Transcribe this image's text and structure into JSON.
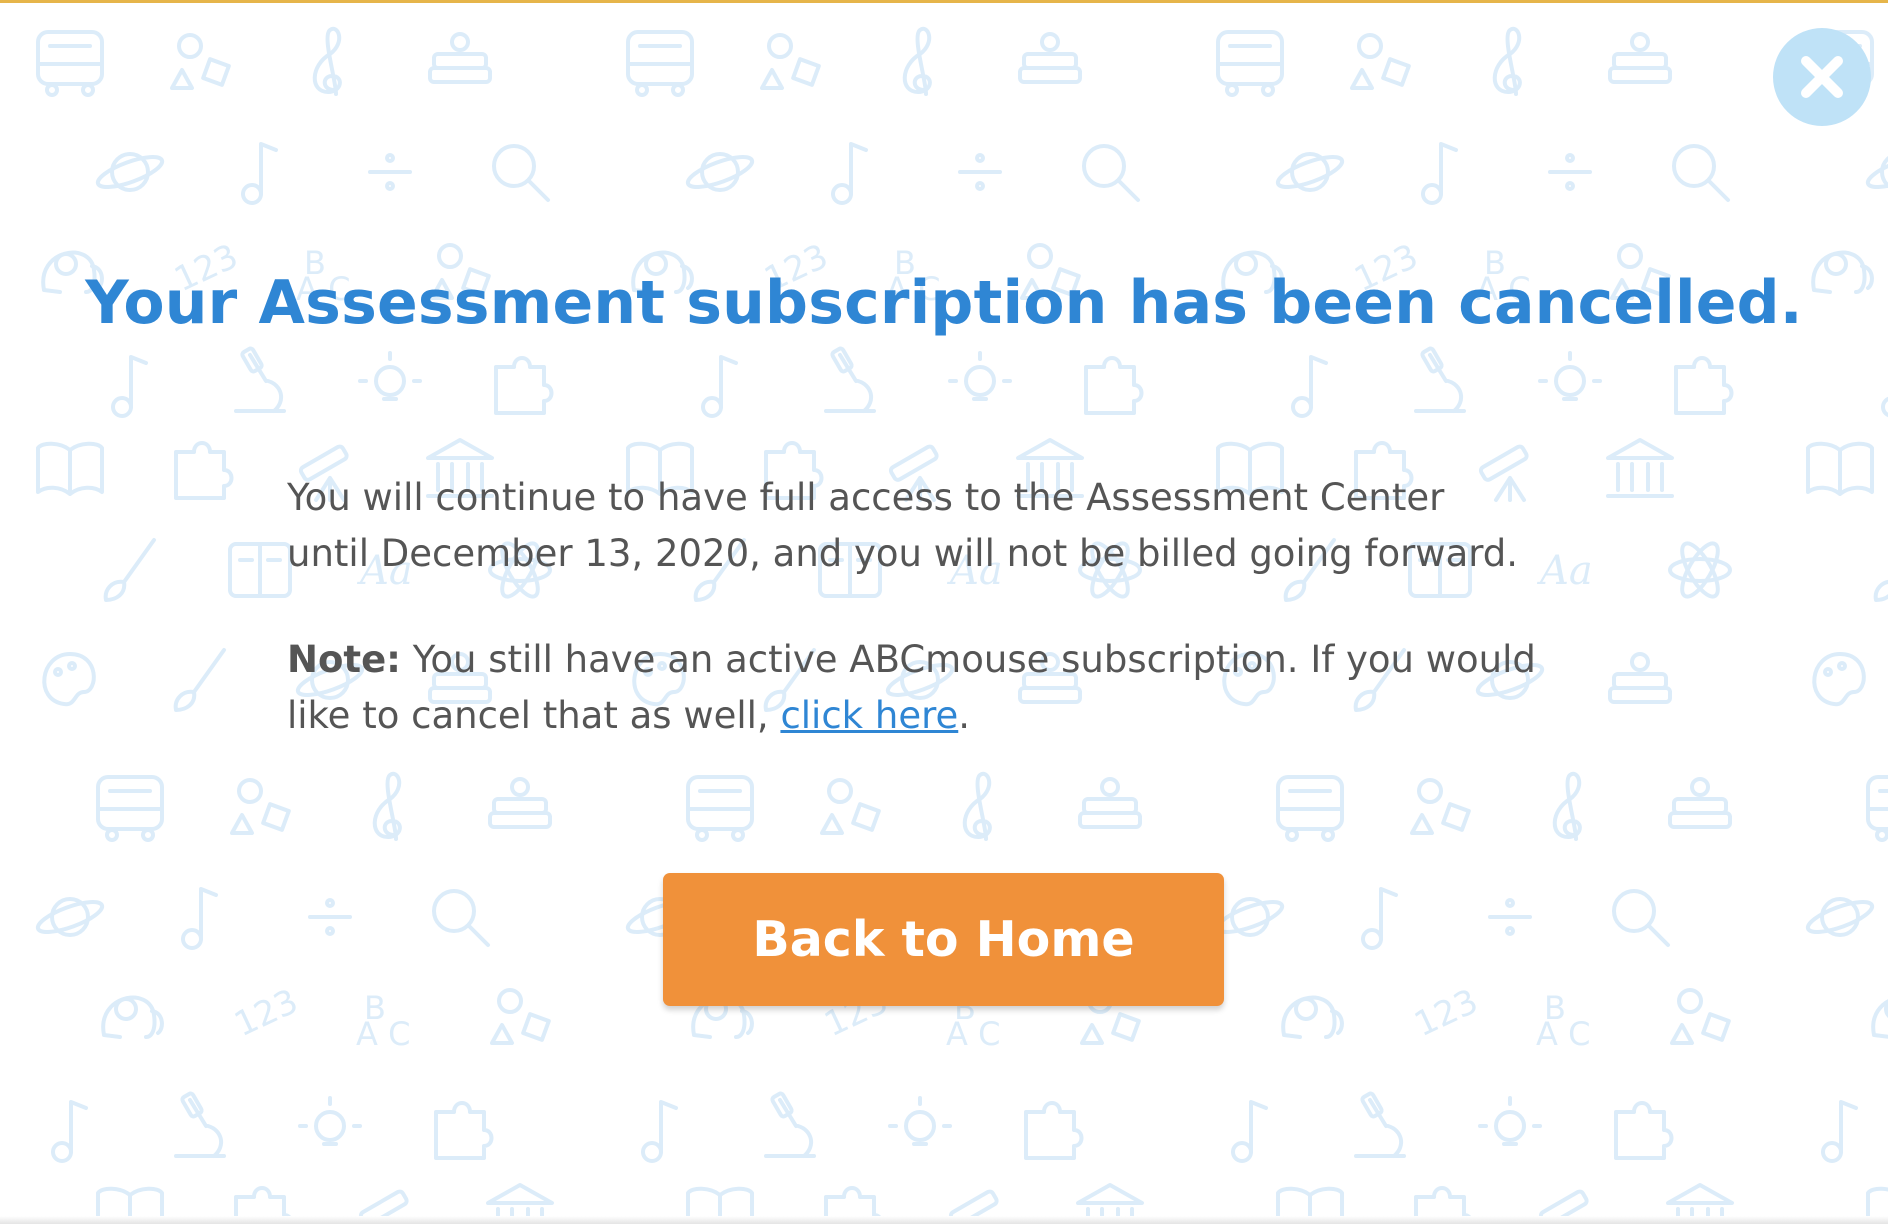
{
  "modal": {
    "title": "Your Assessment subscription has been cancelled.",
    "paragraph1_line1": "You will continue to have full access to the Assessment Center",
    "paragraph1_line2": "until December 13, 2020, and you will not be billed going forward.",
    "note_label": "Note:",
    "note_text_line1": " You still have an active ABCmouse subscription. If you would",
    "note_text_line2": "like to cancel that as well, ",
    "note_link": "click here",
    "note_end": ".",
    "button_label": "Back to Home",
    "close_icon": "close-icon"
  },
  "colors": {
    "title": "#2f86d4",
    "body_text": "#555555",
    "link": "#2f86d4",
    "button": "#f0913a",
    "close_button": "#bfe2f7",
    "pattern": "#dcecf9",
    "top_border": "#e6b54a"
  }
}
